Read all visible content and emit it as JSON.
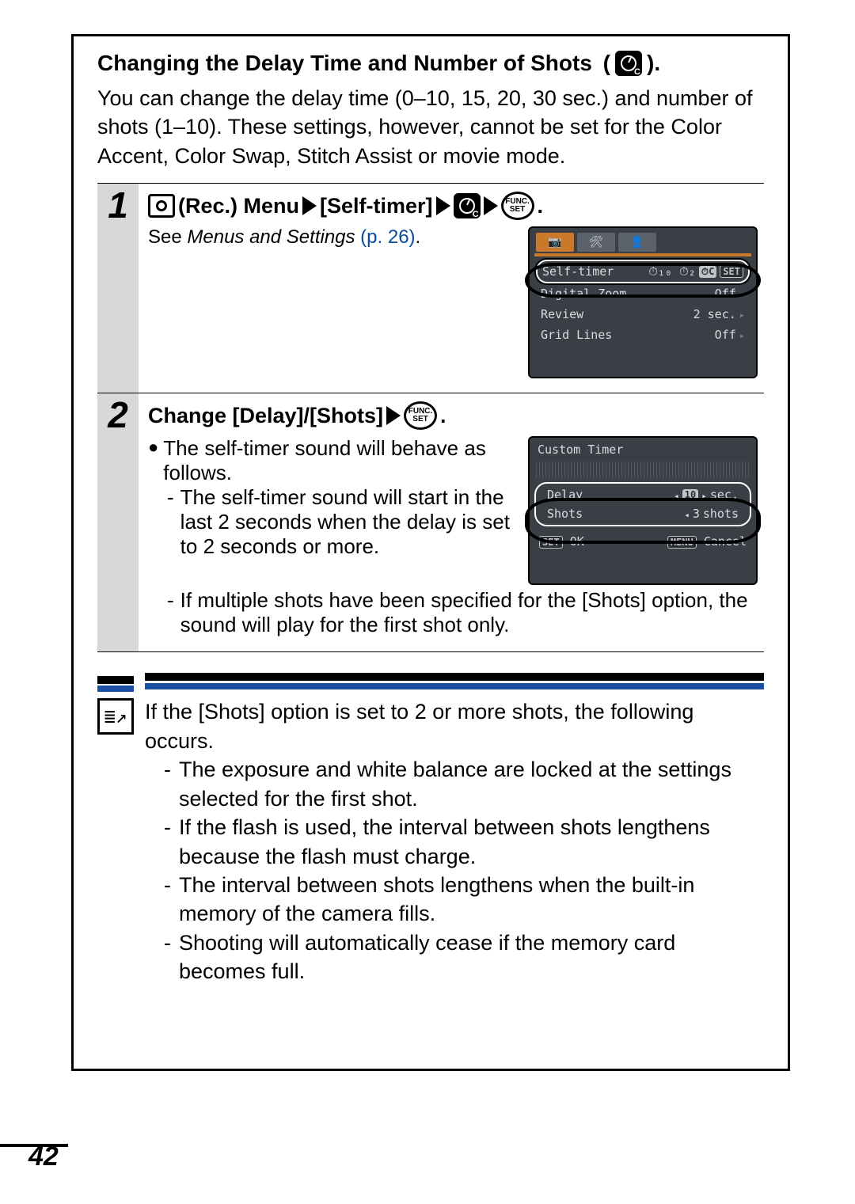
{
  "title_prefix": "Changing the Delay Time and Number of Shots",
  "intro": "You can change the delay time (0–10, 15, 20, 30 sec.) and number of shots (1–10). These settings, however, cannot be set for the Color Accent, Color Swap, Stitch Assist or movie mode.",
  "step1": {
    "num": "1",
    "title_rec_menu": "(Rec.) Menu",
    "title_self_timer": "[Self-timer]",
    "title_period": ".",
    "see_prefix": "See ",
    "see_italic": "Menus and Settings",
    "see_link": " (p. 26)",
    "see_period": ".",
    "func_top": "FUNC.",
    "func_bot": "SET",
    "lcd": {
      "tab_camera": "📷",
      "tab_tools": "🛠",
      "tab_person": "👤",
      "row_selftimer": "Self-timer",
      "row_selftimer_icons": "⏱₁₀ ⏱₂",
      "row_selftimer_set": "SET",
      "row_digitalzoom": "Digital Zoom",
      "row_digitalzoom_v": "Off",
      "row_review": "Review",
      "row_review_v": "2 sec.",
      "row_gridlines": "Grid Lines",
      "row_gridlines_v": "Off"
    }
  },
  "step2": {
    "num": "2",
    "title_change": "Change [Delay]/[Shots]",
    "title_period": ".",
    "func_top": "FUNC.",
    "func_bot": "SET",
    "bullet_intro": "The self-timer sound will behave as follows.",
    "dash1": "The self-timer sound will start in the last 2 seconds when the delay is set to 2 seconds or more.",
    "dash2": "If multiple shots have been specified for the [Shots] option, the sound will play for the first shot only.",
    "lcd": {
      "title": "Custom Timer",
      "row_delay": "Delay",
      "row_delay_val": "10",
      "row_delay_unit": "sec.",
      "row_shots": "Shots",
      "row_shots_val": "3",
      "row_shots_unit": "shots",
      "set_label": "SET",
      "ok_label": "OK",
      "menu_label": "MENU",
      "cancel_label": "Cancel"
    }
  },
  "note": {
    "icon_glyph": "≣↗",
    "intro": "If the [Shots] option is set to 2 or more shots, the following occurs.",
    "d1": "The exposure and white balance are locked at the settings selected for the first shot.",
    "d2": "If the flash is used, the interval between shots lengthens because the flash must charge.",
    "d3": "The interval between shots lengthens when the built-in memory of the camera fills.",
    "d4": "Shooting will automatically cease if the memory card becomes full."
  },
  "page_number": "42"
}
